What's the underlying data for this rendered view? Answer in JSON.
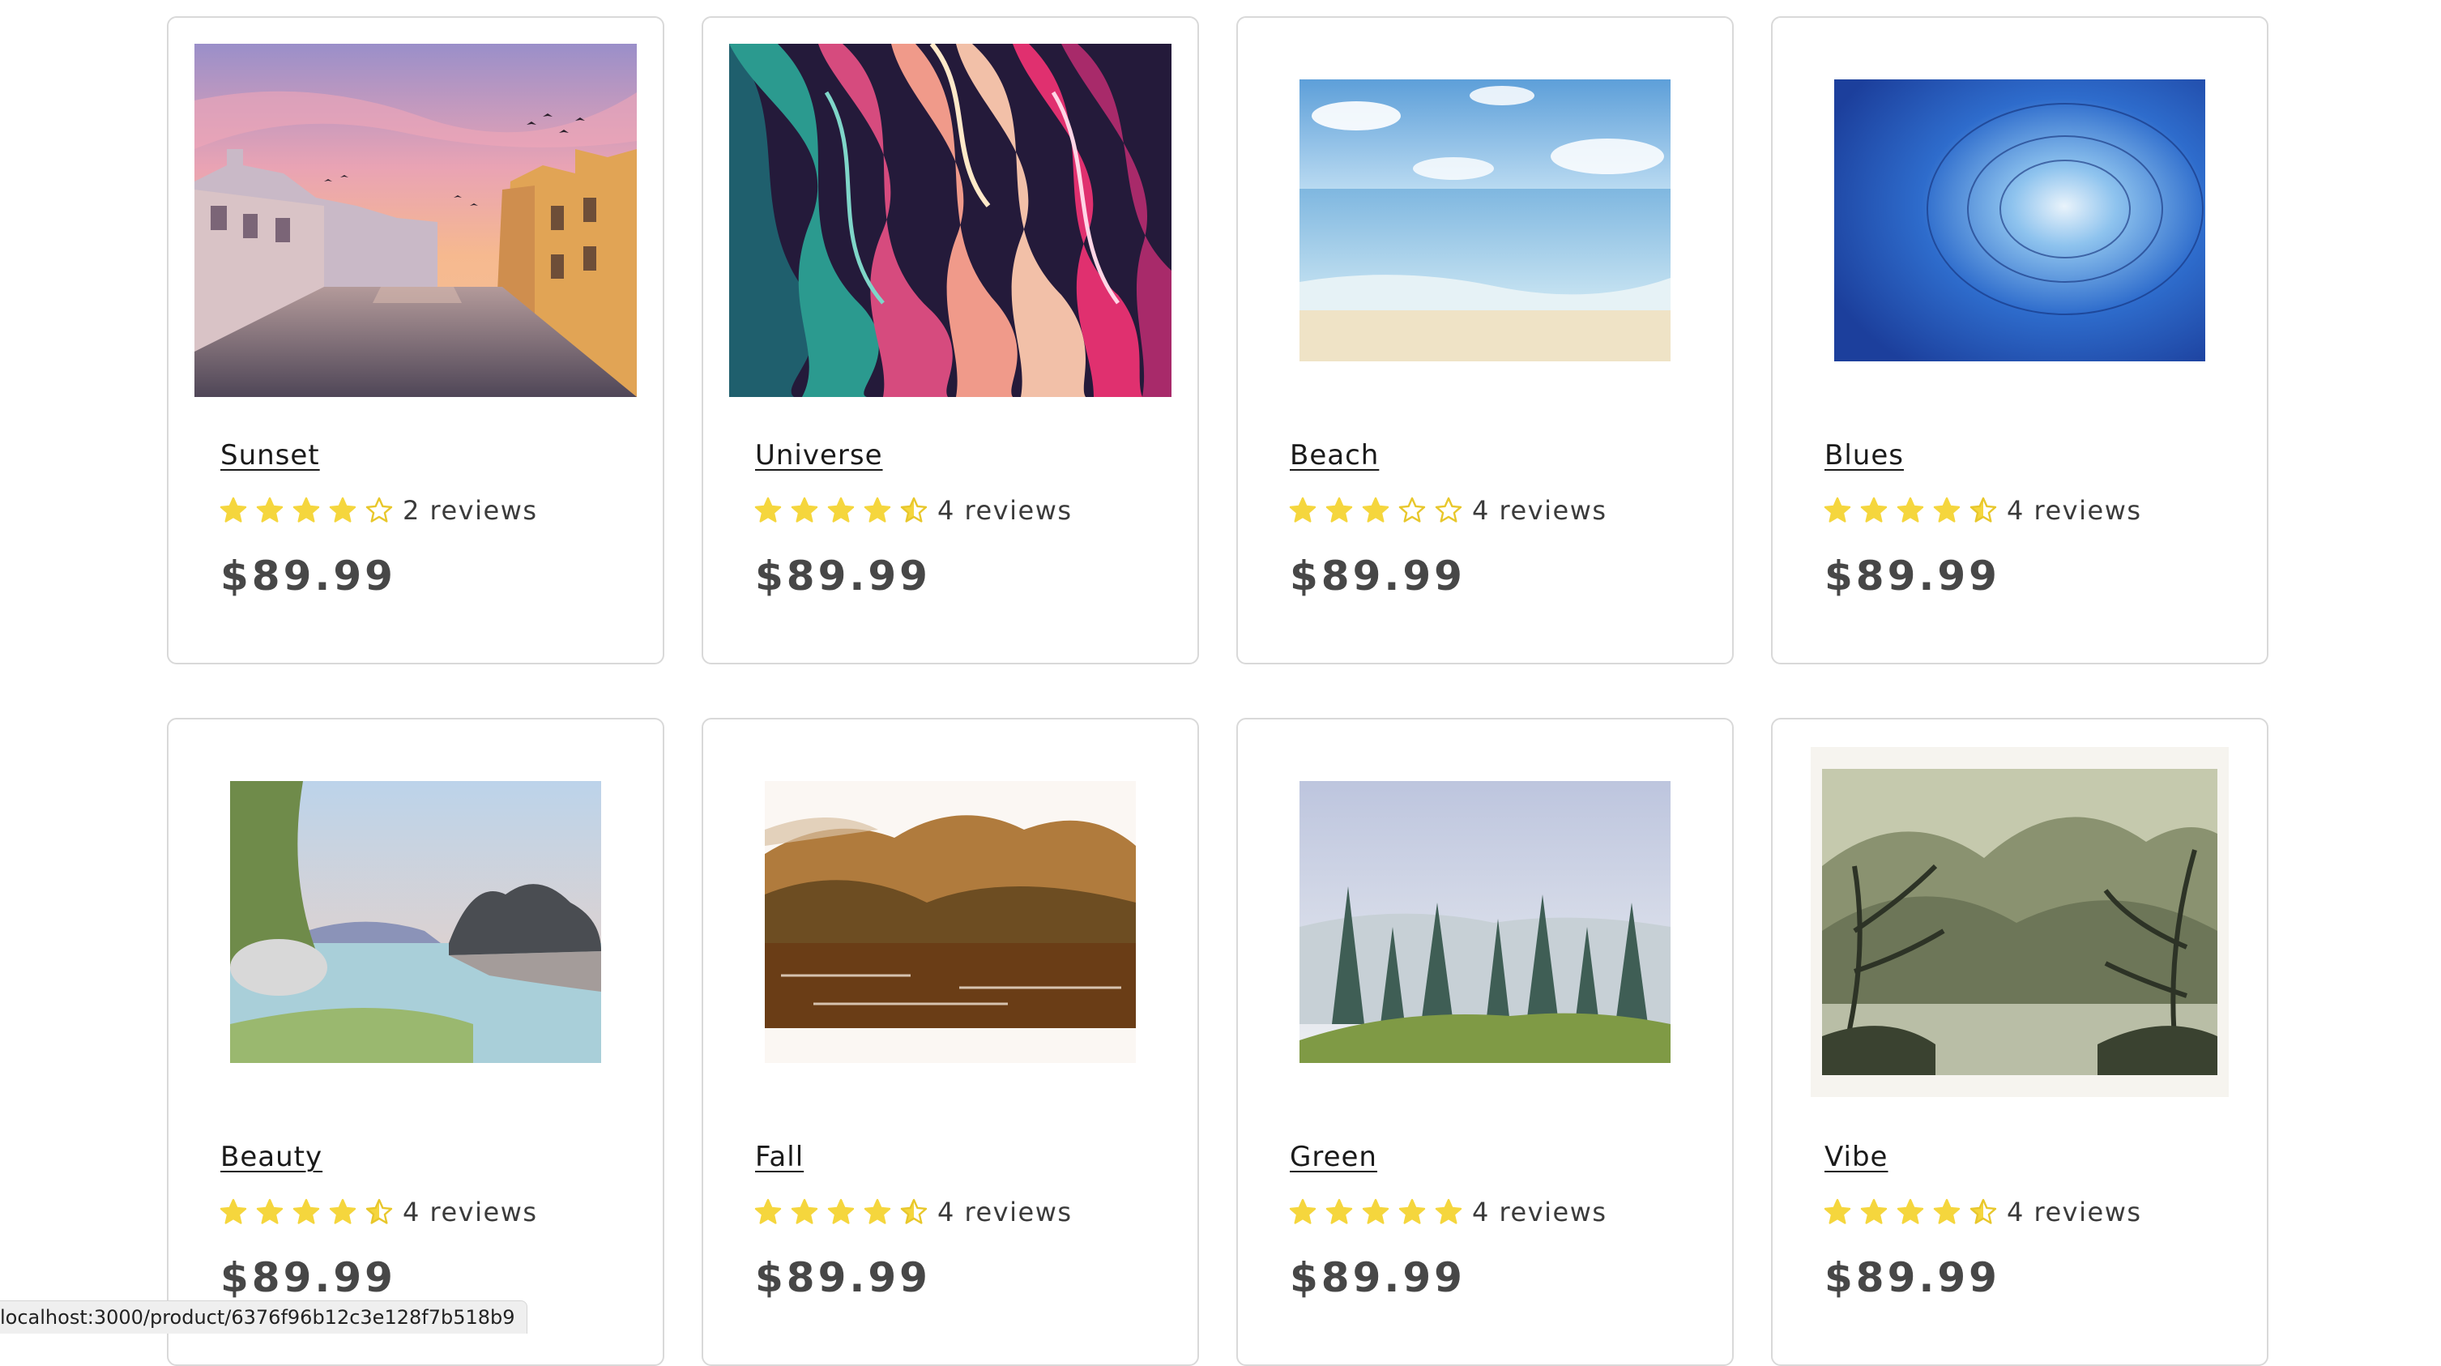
{
  "colors": {
    "star": "#f5d63d",
    "star_outline": "#e8c72b",
    "card_border": "#d9d9d9",
    "price": "#474747"
  },
  "products": [
    {
      "name": "Sunset",
      "rating": 4,
      "reviews_text": "2 reviews",
      "price": "$89.99",
      "art": "sunset"
    },
    {
      "name": "Universe",
      "rating": 4.5,
      "reviews_text": "4 reviews",
      "price": "$89.99",
      "art": "universe"
    },
    {
      "name": "Beach",
      "rating": 3,
      "reviews_text": "4 reviews",
      "price": "$89.99",
      "art": "beach"
    },
    {
      "name": "Blues",
      "rating": 4.5,
      "reviews_text": "4 reviews",
      "price": "$89.99",
      "art": "blues"
    },
    {
      "name": "Beauty",
      "rating": 4.5,
      "reviews_text": "4 reviews",
      "price": "$89.99",
      "art": "beauty"
    },
    {
      "name": "Fall",
      "rating": 4.5,
      "reviews_text": "4 reviews",
      "price": "$89.99",
      "art": "fall"
    },
    {
      "name": "Green",
      "rating": 5,
      "reviews_text": "4 reviews",
      "price": "$89.99",
      "art": "green"
    },
    {
      "name": "Vibe",
      "rating": 4.5,
      "reviews_text": "4 reviews",
      "price": "$89.99",
      "art": "vibe"
    }
  ],
  "status_bar": {
    "url": "localhost:3000/product/6376f96b12c3e128f7b518b9"
  }
}
